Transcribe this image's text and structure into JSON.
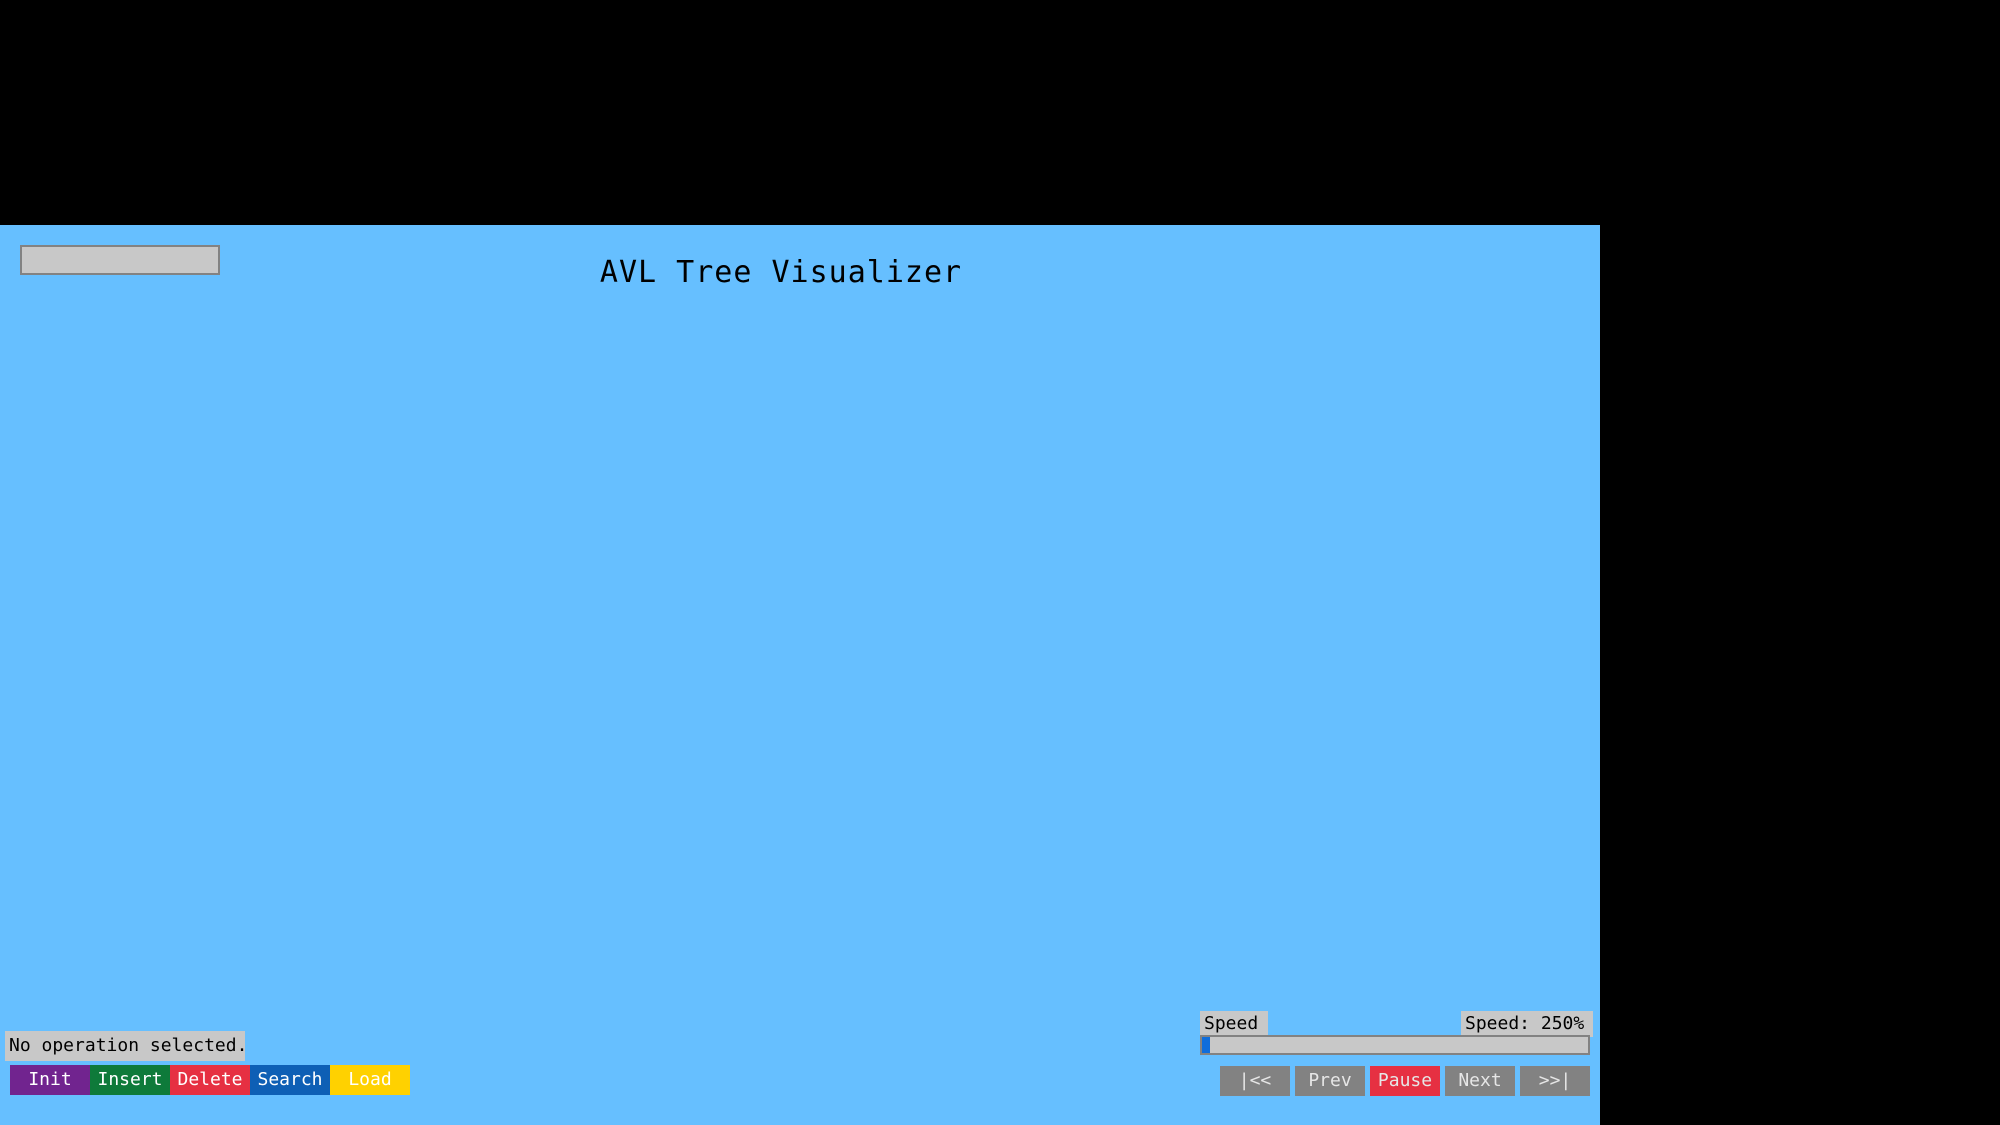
{
  "app": {
    "title": "AVL Tree Visualizer",
    "status_text": "No operation selected.",
    "value_input": {
      "value": ""
    }
  },
  "operations": [
    {
      "label": "Init",
      "color": "#71248F"
    },
    {
      "label": "Insert",
      "color": "#0E7A3A"
    },
    {
      "label": "Delete",
      "color": "#E63042"
    },
    {
      "label": "Search",
      "color": "#0E5FB5"
    },
    {
      "label": "Load",
      "color": "#FFD100"
    }
  ],
  "playback": {
    "speed_label": "Speed",
    "speed_text": "Speed: 250%",
    "speed_fraction": 0.02,
    "buttons": [
      {
        "label": "|<<",
        "name": "first-step-button"
      },
      {
        "label": "Prev",
        "name": "prev-button"
      },
      {
        "label": "Pause",
        "name": "pause-button",
        "color": "#E63042"
      },
      {
        "label": "Next",
        "name": "next-button"
      },
      {
        "label": ">>|",
        "name": "last-step-button"
      }
    ]
  },
  "colors": {
    "canvas_background": "#66BFFF",
    "panel_gray": "#C8C8C8",
    "button_gray": "#828282",
    "slider_fill": "#0F6DDB"
  }
}
